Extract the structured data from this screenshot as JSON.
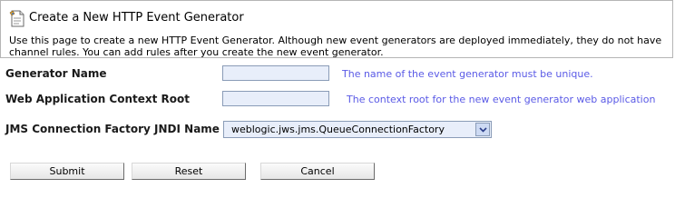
{
  "header": {
    "title": "Create a New HTTP Event Generator",
    "icon": "generator-document-icon",
    "description_line1": "Use this page to create a new HTTP Event Generator. Although new event generators are deployed immediately, they do not have",
    "description_line2": "channel rules. You can add rules after you create the new event generator."
  },
  "form": {
    "generator_name": {
      "label": "Generator Name",
      "value": "",
      "hint": "The name of the event generator must be unique."
    },
    "context_root": {
      "label": "Web Application Context Root",
      "value": "",
      "hint": "The context root for the new event generator web application"
    },
    "jms_factory": {
      "label": "JMS Connection Factory JNDI Name",
      "selected": "weblogic.jws.jms.QueueConnectionFactory"
    }
  },
  "buttons": {
    "submit": "Submit",
    "reset": "Reset",
    "cancel": "Cancel"
  },
  "colors": {
    "hint_text": "#5a5ae6",
    "input_bg": "#e8eefa",
    "input_border": "#8a9cb7"
  }
}
